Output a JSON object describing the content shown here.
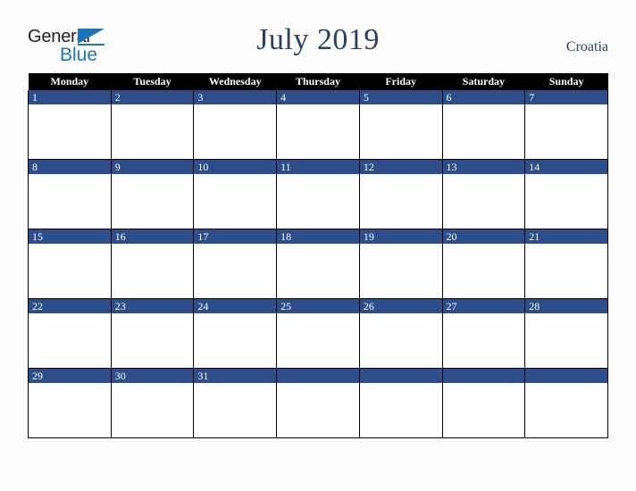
{
  "logo": {
    "word_one": "General",
    "word_two": "Blue",
    "triangle_icon": "triangle-icon",
    "brand_blue": "#1a75bb",
    "brand_dark": "#231f20"
  },
  "header": {
    "title": "July 2019",
    "region": "Croatia",
    "title_color": "#2b3f66"
  },
  "calendar": {
    "month": "July",
    "year": "2019",
    "week_start": "Monday",
    "header_bg": "#000000",
    "header_text_color": "#ffffff",
    "day_bar_color": "#2e4d8b",
    "day_number_color": "#ffffff",
    "cell_bg": "#ffffff",
    "grid_line_color": "#000000",
    "weekday_headers": [
      "Monday",
      "Tuesday",
      "Wednesday",
      "Thursday",
      "Friday",
      "Saturday",
      "Sunday"
    ],
    "weeks": [
      [
        "1",
        "2",
        "3",
        "4",
        "5",
        "6",
        "7"
      ],
      [
        "8",
        "9",
        "10",
        "11",
        "12",
        "13",
        "14"
      ],
      [
        "15",
        "16",
        "17",
        "18",
        "19",
        "20",
        "21"
      ],
      [
        "22",
        "23",
        "24",
        "25",
        "26",
        "27",
        "28"
      ],
      [
        "29",
        "30",
        "31",
        "",
        "",
        "",
        ""
      ]
    ]
  },
  "page": {
    "background": "#fdfdfd"
  }
}
